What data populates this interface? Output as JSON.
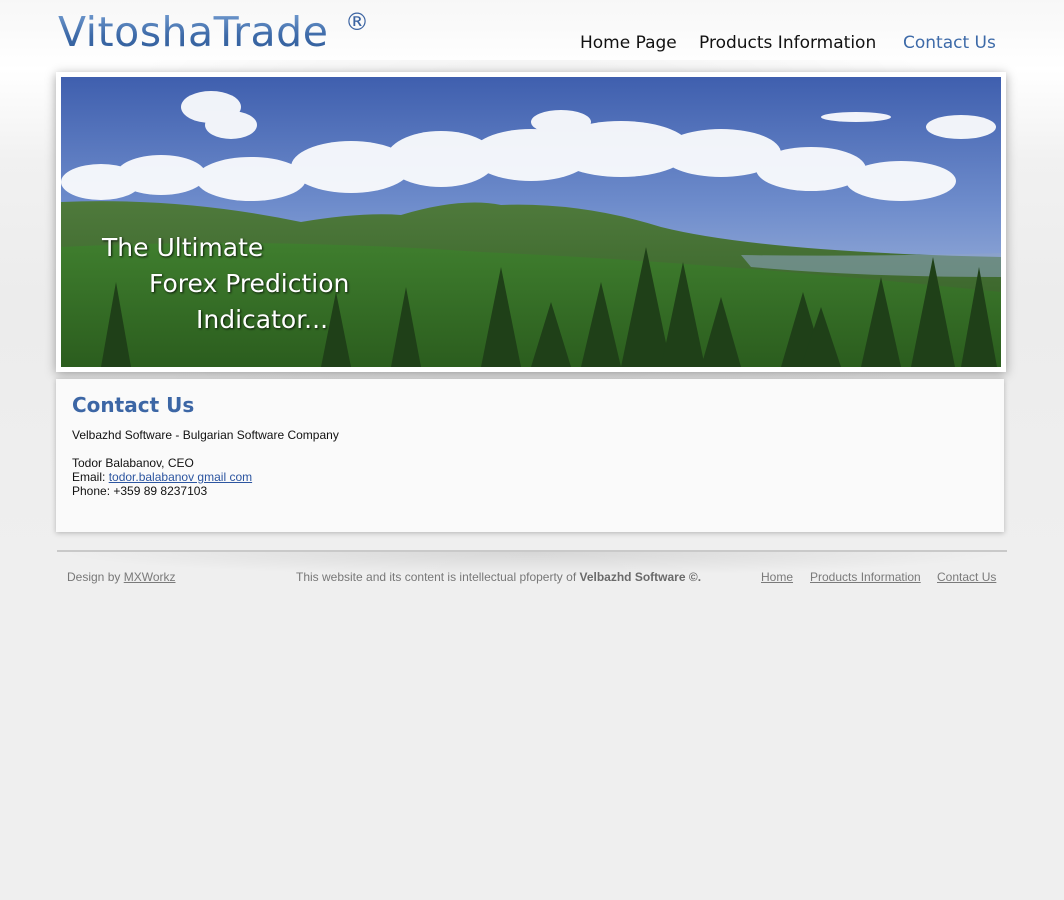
{
  "site": {
    "logo": "VitoshaTrade",
    "logo_mark": "®"
  },
  "nav": {
    "items": [
      {
        "label": "Home Page"
      },
      {
        "label": "Products Information"
      },
      {
        "label": "Contact Us"
      }
    ],
    "active": "Contact Us"
  },
  "banner": {
    "tagline_1": "The Ultimate",
    "tagline_2": "Forex Prediction",
    "tagline_3": "Indicator..."
  },
  "contact": {
    "title": "Contact Us",
    "company": "Velbazhd Software - Bulgarian Software Company",
    "person": "Todor Balabanov, CEO",
    "email_label": "Email:",
    "email": "todor.balabanov gmail com",
    "phone": "Phone: +359 89 8237103"
  },
  "footer": {
    "design_label": "Design by",
    "design_link": "MXWorkz",
    "notice_prefix": "This website and its content is intellectual pfoperty of",
    "notice_company": "Velbazhd Software ©.",
    "links": [
      {
        "label": "Home"
      },
      {
        "label": "Products Information"
      },
      {
        "label": "Contact Us"
      }
    ]
  },
  "colors": {
    "accent": "#3d6aa8",
    "background": "#efefef",
    "panel": "#fafafa"
  }
}
